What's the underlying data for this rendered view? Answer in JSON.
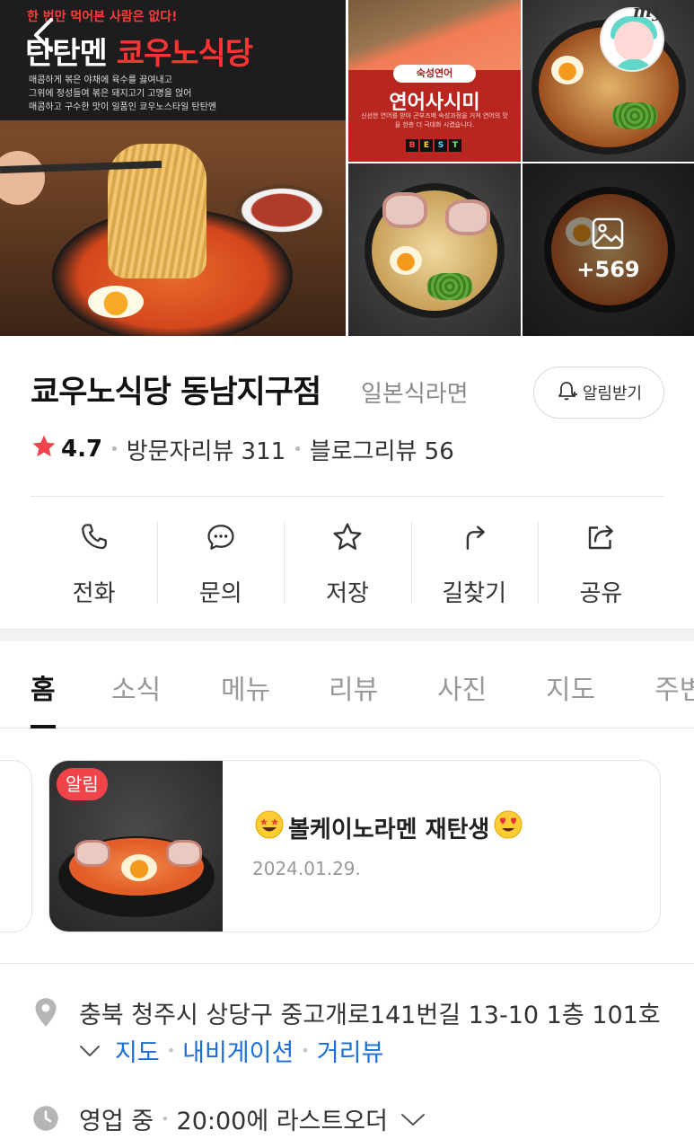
{
  "gallery": {
    "main_photo": {
      "tagline": "한 번만 먹어본 사람은 없다!",
      "headline_white": "탄탄멘",
      "headline_red": "쿄우노식당",
      "description_lines": [
        "매콤하게 볶은 야채에 육수를 끓여내고",
        "그위에 정성들여 볶은 돼지고기 고명을 얹어",
        "매콤하고 구수한 맛이 일품인 쿄우노스타일 탄탄멘"
      ]
    },
    "salmon_photo": {
      "pill": "숙성연어",
      "title": "연어사시미",
      "sub": "신선한 연어를 받아 곤부즈메 숙성과정을 거쳐 연어의 맛을 한층 더 극대화 시켰습니다.",
      "best": [
        "B",
        "E",
        "S",
        "T"
      ]
    },
    "more_count": "+569",
    "my_label": "my"
  },
  "place": {
    "name": "쿄우노식당 동남지구점",
    "category": "일본식라면",
    "notify_label": "알림받기",
    "rating": "4.7",
    "visitor_reviews": "방문자리뷰 311",
    "blog_reviews": "블로그리뷰 56"
  },
  "actions": [
    {
      "label": "전화",
      "icon": "phone-icon"
    },
    {
      "label": "문의",
      "icon": "chat-icon"
    },
    {
      "label": "저장",
      "icon": "star-icon"
    },
    {
      "label": "길찾기",
      "icon": "directions-icon"
    },
    {
      "label": "공유",
      "icon": "share-icon"
    }
  ],
  "tabs": [
    "홈",
    "소식",
    "메뉴",
    "리뷰",
    "사진",
    "지도",
    "주변"
  ],
  "active_tab": "홈",
  "notice": {
    "badge": "알림",
    "title": "볼케이노라멘 재탄생",
    "date": "2024.01.29."
  },
  "address": {
    "text": "충북 청주시 상당구 중고개로141번길 13-10 1층 101호",
    "links": [
      "지도",
      "내비게이션",
      "거리뷰"
    ]
  },
  "hours": {
    "status": "영업 중",
    "last_order": "20:00에 라스트오더"
  },
  "colors": {
    "accent_red": "#f0444a",
    "link_blue": "#1b6ed8",
    "star_red": "#f0444a"
  }
}
